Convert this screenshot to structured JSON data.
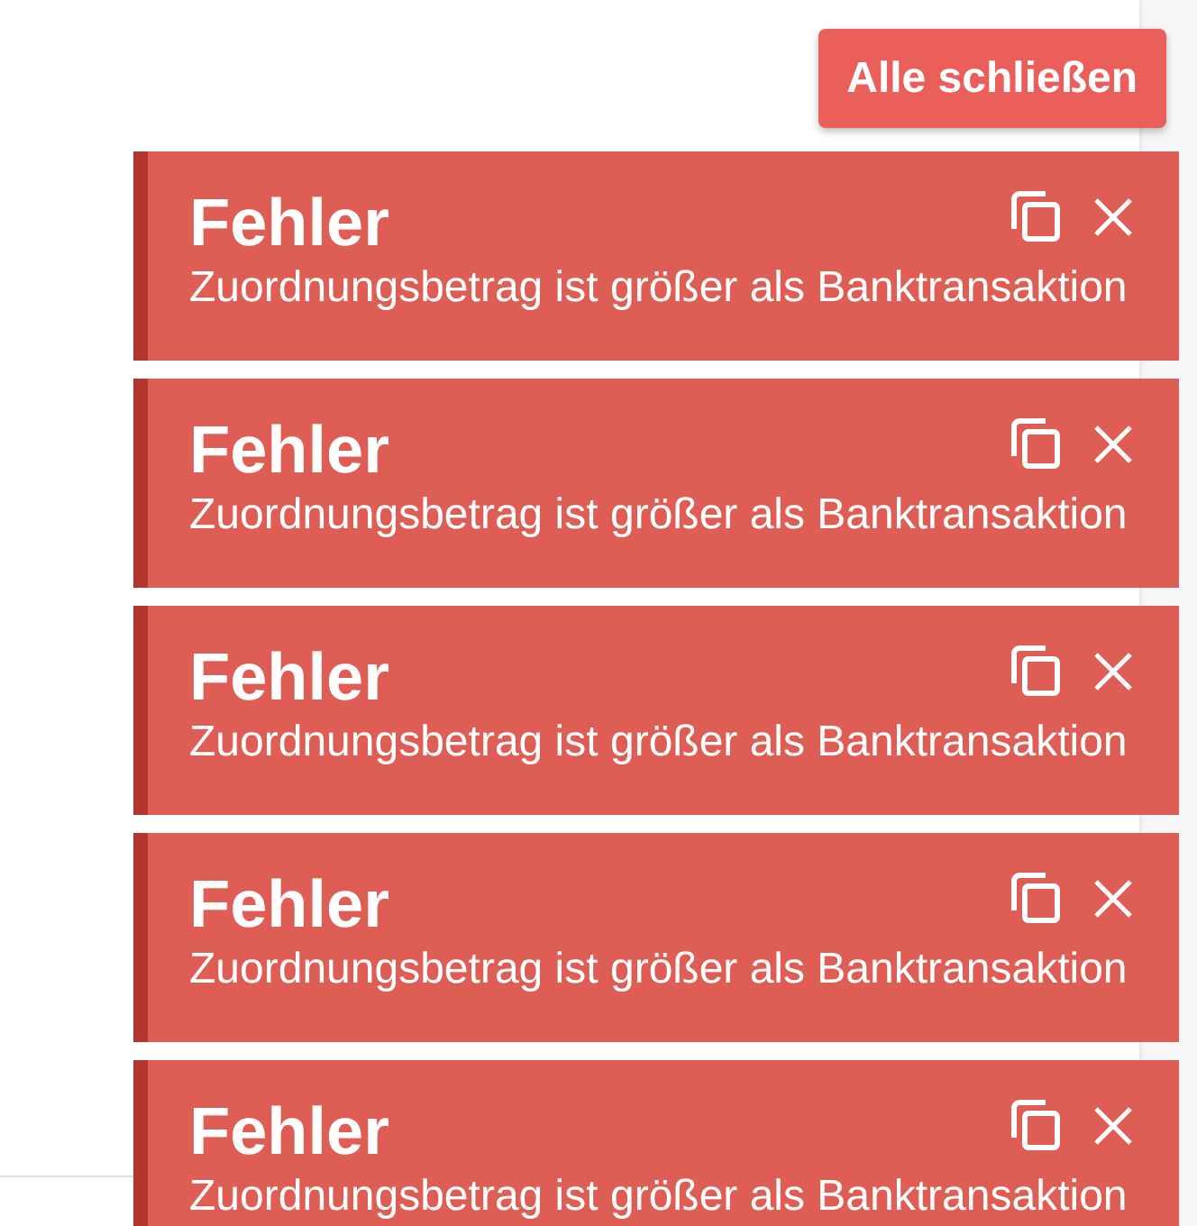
{
  "close_all_button": {
    "label": "Alle schließen"
  },
  "toasts": [
    {
      "title": "Fehler",
      "message": "Zuordnungsbetrag ist größer als Banktransaktion"
    },
    {
      "title": "Fehler",
      "message": "Zuordnungsbetrag ist größer als Banktransaktion"
    },
    {
      "title": "Fehler",
      "message": "Zuordnungsbetrag ist größer als Banktransaktion"
    },
    {
      "title": "Fehler",
      "message": "Zuordnungsbetrag ist größer als Banktransaktion"
    },
    {
      "title": "Fehler",
      "message": "Zuordnungsbetrag ist größer als Banktransaktion"
    }
  ]
}
